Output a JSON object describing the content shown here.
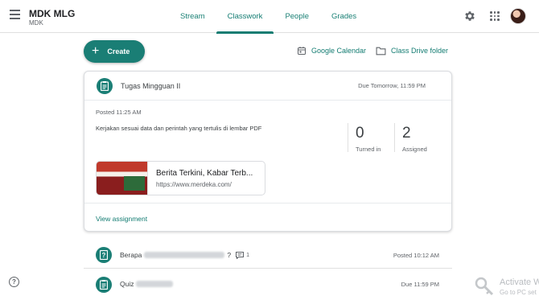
{
  "header": {
    "class_name": "MDK MLG",
    "section": "MDK",
    "tabs": [
      {
        "label": "Stream",
        "active": false
      },
      {
        "label": "Classwork",
        "active": true
      },
      {
        "label": "People",
        "active": false
      },
      {
        "label": "Grades",
        "active": false
      }
    ],
    "icons": [
      "menu-icon",
      "gear-icon",
      "apps-grid-icon",
      "avatar"
    ]
  },
  "toolbar": {
    "create_label": "Create",
    "calendar_label": "Google Calendar",
    "drive_label": "Class Drive folder"
  },
  "assignment": {
    "title": "Tugas Mingguan II",
    "due": "Due Tomorrow, 11:59 PM",
    "posted": "Posted 11:25 AM",
    "description": "Kerjakan sesuai data dan perintah yang tertulis di lembar PDF",
    "turned_in_count": "0",
    "turned_in_label": "Turned in",
    "assigned_count": "2",
    "assigned_label": "Assigned",
    "attachment": {
      "title": "Berita Terkini, Kabar Terb...",
      "url": "https://www.merdeka.com/"
    },
    "view_label": "View assignment"
  },
  "items": [
    {
      "prefix": "Berapa",
      "suffix": "?",
      "comment_count": "1",
      "meta": "Posted 10:12 AM"
    },
    {
      "prefix": "Quiz",
      "suffix": "",
      "comment_count": "",
      "meta": "Due 11:59 PM"
    }
  ],
  "watermark": {
    "line1": "Activate W",
    "line2": "Go to PC set"
  },
  "colors": {
    "accent": "#1a7e75",
    "text": "#3c4043",
    "muted": "#5f6368"
  }
}
